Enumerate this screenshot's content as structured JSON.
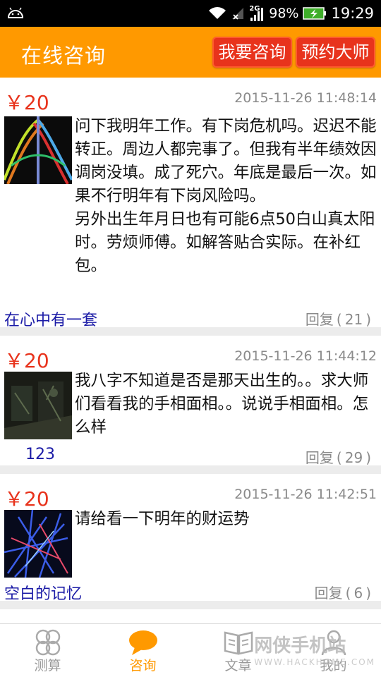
{
  "status_bar": {
    "battery": "98%",
    "time": "19:29",
    "network": "2G"
  },
  "header": {
    "title": "在线咨询",
    "consult_button": "我要咨询",
    "book_button": "预约大师"
  },
  "posts": [
    {
      "price": "￥20",
      "time": "2015-11-26 11:48:14",
      "text": "问下我明年工作。有下岗危机吗。迟迟不能转正。周边人都完事了。但我有半年绩效因调岗没填。成了死穴。年底是最后一次。如果不行明年有下岗风险吗。\n另外出生年月日也有可能6点50白山真太阳时。劳烦师傅。如解答贴合实际。在补红包。",
      "user": "在心中有一套",
      "reply_label": "回复",
      "reply_count": "21"
    },
    {
      "price": "￥20",
      "time": "2015-11-26 11:44:12",
      "text": "我八字不知道是否是那天出生的。。求大师们看看我的手相面相。。说说手相面相。怎么样",
      "user": "123",
      "reply_label": "回复",
      "reply_count": "29"
    },
    {
      "price": "￥20",
      "time": "2015-11-26 11:42:51",
      "text": "请给看一下明年的财运势",
      "user": "空白的记忆",
      "reply_label": "回复",
      "reply_count": "6"
    }
  ],
  "tabs": [
    {
      "label": "测算",
      "icon": "circles-icon"
    },
    {
      "label": "咨询",
      "icon": "chat-bubble-icon"
    },
    {
      "label": "文章",
      "icon": "book-icon"
    },
    {
      "label": "我的",
      "icon": "person-icon"
    }
  ],
  "watermark": {
    "main": "网侠手机站",
    "sub": "WWW.HACKHOME.COM"
  },
  "colors": {
    "accent": "#ff9900",
    "button_red": "#e8331c",
    "price_red": "#e8331c",
    "username_blue": "#1a1aa6"
  }
}
